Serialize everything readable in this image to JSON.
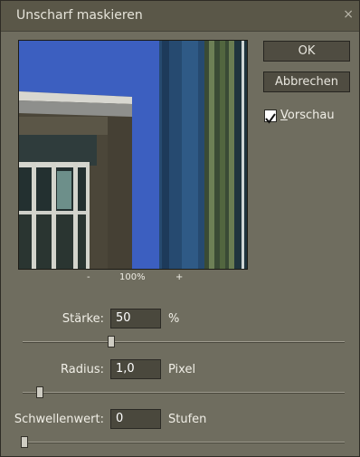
{
  "window": {
    "title": "Unscharf maskieren"
  },
  "buttons": {
    "ok": "OK",
    "cancel": "Abbrechen"
  },
  "preview_option": {
    "checked": true,
    "label_first": "V",
    "label_rest": "orschau"
  },
  "zoom": {
    "minus": "-",
    "level": "100%",
    "plus": "+"
  },
  "fields": [
    {
      "label": "Stärke:",
      "value": "50",
      "unit": "%",
      "slider_fraction": 0.27
    },
    {
      "label": "Radius:",
      "value": "1,0",
      "unit": "Pixel",
      "slider_fraction": 0.05
    },
    {
      "label": "Schwellenwert:",
      "value": "0",
      "unit": "Stufen",
      "slider_fraction": 0.0
    }
  ]
}
